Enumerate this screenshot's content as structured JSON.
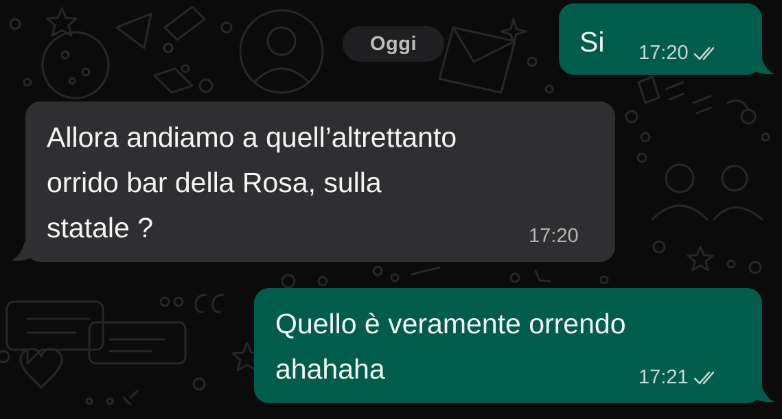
{
  "chat": {
    "day_label": "Oggi",
    "messages": [
      {
        "direction": "outgoing",
        "lines": [
          "Si"
        ],
        "time": "17:20",
        "status_icon": "double-check-icon"
      },
      {
        "direction": "incoming",
        "lines": [
          "Allora andiamo a quell’altrettanto",
          "orrido bar della Rosa, sulla",
          "statale ?"
        ],
        "time": "17:20"
      },
      {
        "direction": "outgoing",
        "lines": [
          "Quello è veramente orrendo",
          "ahahaha"
        ],
        "time": "17:21",
        "status_icon": "double-check-icon"
      }
    ]
  },
  "colors": {
    "background": "#0b0b0c",
    "outgoing_bubble": "#005c4b",
    "incoming_bubble": "#2f2f31",
    "day_badge": "#1f1f21"
  }
}
